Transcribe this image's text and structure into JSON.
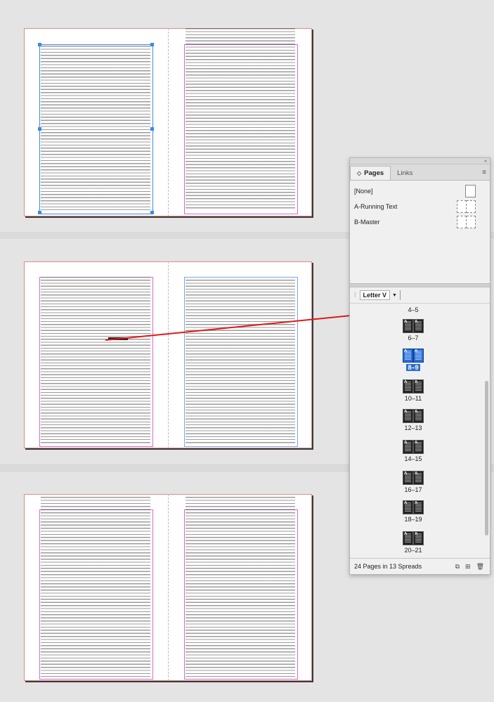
{
  "panel": {
    "tabs": [
      {
        "label": "Pages",
        "active": true
      },
      {
        "label": "Links",
        "active": false
      }
    ],
    "masters": [
      {
        "label": "[None]",
        "kind": "single"
      },
      {
        "label": "A-Running Text",
        "kind": "double"
      },
      {
        "label": "B-Master",
        "kind": "double"
      }
    ],
    "page_size": "Letter V",
    "spreads": [
      {
        "label": "4–5",
        "selected": false
      },
      {
        "label": "6–7",
        "selected": false
      },
      {
        "label": "8–9",
        "selected": true
      },
      {
        "label": "10–11",
        "selected": false
      },
      {
        "label": "12–13",
        "selected": false
      },
      {
        "label": "14–15",
        "selected": false
      },
      {
        "label": "16–17",
        "selected": false
      },
      {
        "label": "18–19",
        "selected": false
      },
      {
        "label": "20–21",
        "selected": false
      }
    ],
    "master_letter": "A",
    "status": "24 Pages in 13 Spreads",
    "icons": [
      "page-size-icon",
      "new-page-icon",
      "delete-page-icon"
    ]
  },
  "colors": {
    "selection": "#3b8be0",
    "margin": "#d46bd4",
    "bleed": "#e08a8a",
    "arrow": "#e01818",
    "thumb_selected": "#2c6fd1"
  }
}
